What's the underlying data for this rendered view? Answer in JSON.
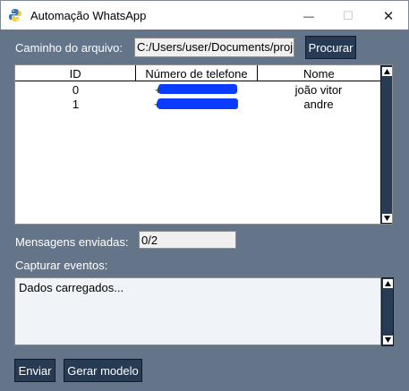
{
  "window": {
    "title": "Automação WhatsApp",
    "minimize": "—",
    "maximize": "☐",
    "close": "✕"
  },
  "file": {
    "label": "Caminho do arquivo:",
    "value": "C:/Users/user/Documents/proj",
    "browse_label": "Procurar"
  },
  "table": {
    "columns": [
      "ID",
      "Número de telefone",
      "Nome"
    ],
    "rows": [
      {
        "id": "0",
        "phone": "+",
        "name": "joão vitor"
      },
      {
        "id": "1",
        "phone": "+",
        "name": "andre"
      }
    ]
  },
  "messages": {
    "label": "Mensagens enviadas:",
    "value": "0/2"
  },
  "events": {
    "label": "Capturar eventos:",
    "log": "Dados carregados..."
  },
  "buttons": {
    "send": "Enviar",
    "model": "Gerar modelo"
  },
  "colors": {
    "background": "#64758a",
    "button": "#283b55",
    "redaction": "#0a3cff"
  }
}
